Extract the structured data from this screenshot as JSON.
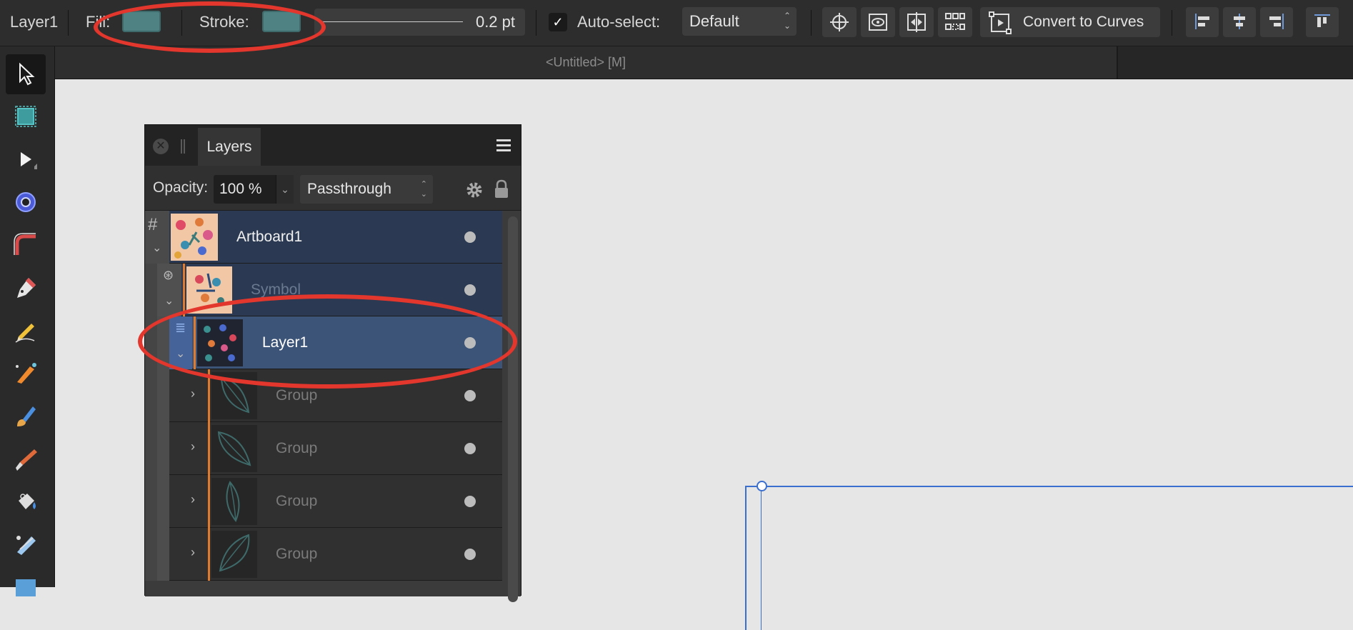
{
  "context_toolbar": {
    "layer_name": "Layer1",
    "fill_label": "Fill:",
    "stroke_label": "Stroke:",
    "stroke_width": "0.2 pt",
    "autoselect_label": "Auto-select:",
    "autoselect_value": "Default",
    "convert_label": "Convert to Curves",
    "swatch_color": "#4e8283"
  },
  "document": {
    "tab_title": "<Untitled> [M]"
  },
  "layers_panel": {
    "tab_label": "Layers",
    "opacity_label": "Opacity:",
    "opacity_value": "100 %",
    "blend_mode": "Passthrough",
    "rows": [
      {
        "name": "Artboard1",
        "selected": true
      },
      {
        "name": "Symbol",
        "selected": true
      },
      {
        "name": "Layer1",
        "selected": true,
        "highlight": true
      },
      {
        "name": "Group"
      },
      {
        "name": "Group"
      },
      {
        "name": "Group"
      },
      {
        "name": "Group"
      }
    ]
  },
  "annotation_color": "#e3362c"
}
